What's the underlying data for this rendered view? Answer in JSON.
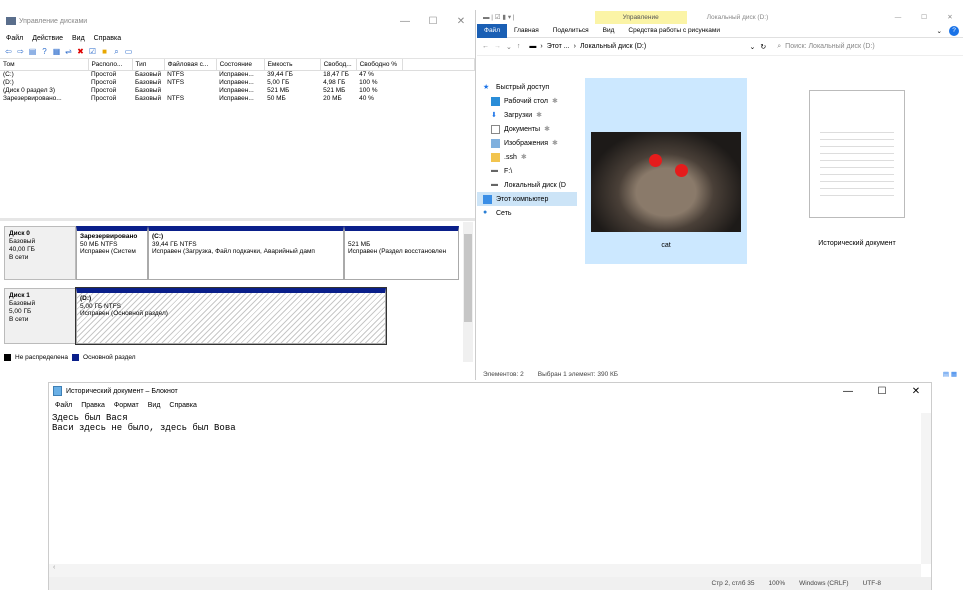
{
  "diskmgmt": {
    "title": "Управление дисками",
    "menu": [
      "Файл",
      "Действие",
      "Вид",
      "Справка"
    ],
    "columns": [
      "Том",
      "Располо...",
      "Тип",
      "Файловая с...",
      "Состояние",
      "Емкость",
      "Свобод...",
      "Свободно %"
    ],
    "volumes": [
      [
        "(C:)",
        "Простой",
        "Базовый",
        "NTFS",
        "Исправен...",
        "39,44 ГБ",
        "18,47 ГБ",
        "47 %"
      ],
      [
        "(D:)",
        "Простой",
        "Базовый",
        "NTFS",
        "Исправен...",
        "5,00 ГБ",
        "4,98 ГБ",
        "100 %"
      ],
      [
        "(Диск 0 раздел 3)",
        "Простой",
        "Базовый",
        "",
        "Исправен...",
        "521 МБ",
        "521 МБ",
        "100 %"
      ],
      [
        "Зарезервировано...",
        "Простой",
        "Базовый",
        "NTFS",
        "Исправен...",
        "50 МБ",
        "20 МБ",
        "40 %"
      ]
    ],
    "disk0": {
      "name": "Диск 0",
      "type": "Базовый",
      "size": "40,00 ГБ",
      "state": "В сети",
      "p1": {
        "name": "Зарезервировано",
        "info": "50 МБ NTFS",
        "status": "Исправен (Систем"
      },
      "p2": {
        "name": "(C:)",
        "info": "39,44 ГБ NTFS",
        "status": "Исправен (Загрузка, Файл подкачки, Аварийный дамп"
      },
      "p3": {
        "name": "",
        "info": "521 МБ",
        "status": "Исправен (Раздел восстановлен"
      }
    },
    "disk1": {
      "name": "Диск 1",
      "type": "Базовый",
      "size": "5,00 ГБ",
      "state": "В сети",
      "p1": {
        "name": "(D:)",
        "info": "5,00 ГБ NTFS",
        "status": "Исправен (Основной раздел)"
      }
    },
    "legend": [
      "Не распределена",
      "Основной раздел"
    ]
  },
  "explorer": {
    "context_tab": "Управление",
    "title": "Локальный диск (D:)",
    "tabs": [
      "Файл",
      "Главная",
      "Поделиться",
      "Вид",
      "Средства работы с рисунками"
    ],
    "path": [
      "Этот ...",
      "Локальный диск (D:)"
    ],
    "search_placeholder": "Поиск: Локальный диск (D:)",
    "nav": [
      "Быстрый доступ",
      "Рабочий стол",
      "Загрузки",
      "Документы",
      "Изображения",
      ".ssh",
      "F:\\",
      "Локальный диск (D",
      "Этот компьютер",
      "Сеть"
    ],
    "files": [
      "cat",
      "Исторический документ"
    ],
    "status": [
      "Элементов: 2",
      "Выбран 1 элемент: 390 КБ"
    ]
  },
  "notepad": {
    "title": "Исторический документ – Блокнот",
    "menu": [
      "Файл",
      "Правка",
      "Формат",
      "Вид",
      "Справка"
    ],
    "lines": [
      "Здесь был Вася",
      "Васи здесь не было, здесь был Вова"
    ],
    "status": [
      "Стр 2, стлб 35",
      "100%",
      "Windows (CRLF)",
      "UTF-8"
    ]
  }
}
